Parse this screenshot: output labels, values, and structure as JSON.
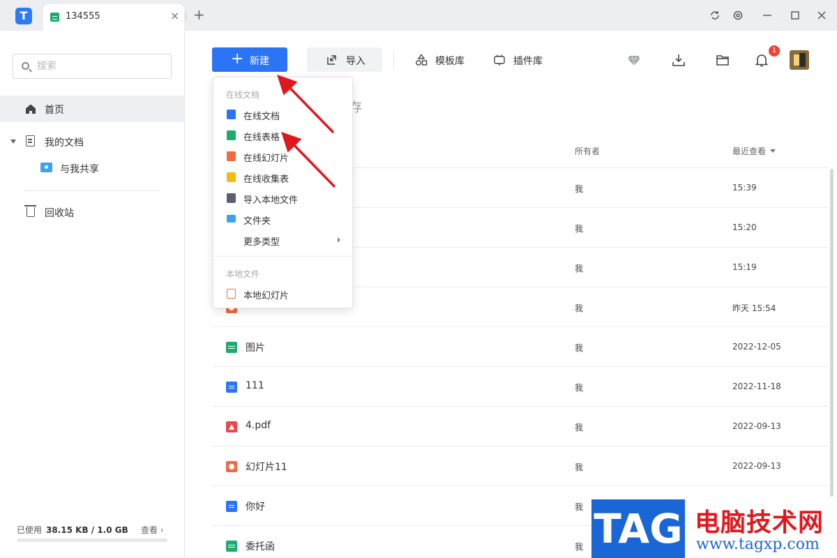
{
  "titlebar": {
    "tab_title": "134555",
    "tab_close": "×",
    "tab_add": "+",
    "controls": [
      "sync-icon",
      "settings-icon",
      "minimize-icon",
      "maximize-icon",
      "close-icon"
    ]
  },
  "sidebar": {
    "search_placeholder": "搜索",
    "home": "首页",
    "my_docs": "我的文档",
    "shared": "与我共享",
    "trash": "回收站",
    "usage_label": "已使用",
    "usage_value": "38.15 KB / 1.0 GB",
    "usage_view": "查看 ›",
    "usage_fraction": 0.0
  },
  "toolbar": {
    "new_label": "新建",
    "import_label": "导入",
    "template_label": "模板库",
    "plugin_label": "插件库",
    "notification_count": "1"
  },
  "section_title_visible": "缓存",
  "table": {
    "owner_header": "所有者",
    "time_header": "最近查看",
    "rows": [
      {
        "type": "doc",
        "name": "",
        "owner": "我",
        "time": "15:39"
      },
      {
        "type": "doc",
        "name": "",
        "owner": "我",
        "time": "15:20"
      },
      {
        "type": "doc",
        "name": "",
        "owner": "我",
        "time": "15:19"
      },
      {
        "type": "ppt",
        "name": "",
        "owner": "我",
        "time": "昨天 15:54"
      },
      {
        "type": "sheet",
        "name": "图片",
        "owner": "我",
        "time": "2022-12-05"
      },
      {
        "type": "doc",
        "name": "111",
        "owner": "我",
        "time": "2022-11-18"
      },
      {
        "type": "pdf",
        "name": "4.pdf",
        "owner": "我",
        "time": "2022-09-13"
      },
      {
        "type": "ppt",
        "name": "幻灯片11",
        "owner": "我",
        "time": "2022-09-13"
      },
      {
        "type": "doc",
        "name": "你好",
        "owner": "我",
        "time": ""
      },
      {
        "type": "sheet",
        "name": "委托函",
        "owner": "我",
        "time": ""
      }
    ]
  },
  "menu": {
    "group_online": "在线文档",
    "items": [
      {
        "icon": "doc",
        "label": "在线文档"
      },
      {
        "icon": "sheet",
        "label": "在线表格"
      },
      {
        "icon": "ppt",
        "label": "在线幻灯片"
      },
      {
        "icon": "form",
        "label": "在线收集表"
      },
      {
        "icon": "upload",
        "label": "导入本地文件"
      },
      {
        "icon": "folder",
        "label": "文件夹"
      },
      {
        "icon": "none",
        "label": "更多类型"
      }
    ],
    "group_local": "本地文件",
    "local_items": [
      {
        "icon": "localppt",
        "label": "本地幻灯片"
      }
    ]
  },
  "watermark": {
    "logo": "TAG",
    "name": "电脑技术网",
    "url": "www.tagxp.com"
  },
  "colors": {
    "accent": "#2a74f5",
    "annotation": "#e0171c",
    "sheet": "#1aad6b",
    "ppt": "#f26a3e"
  }
}
